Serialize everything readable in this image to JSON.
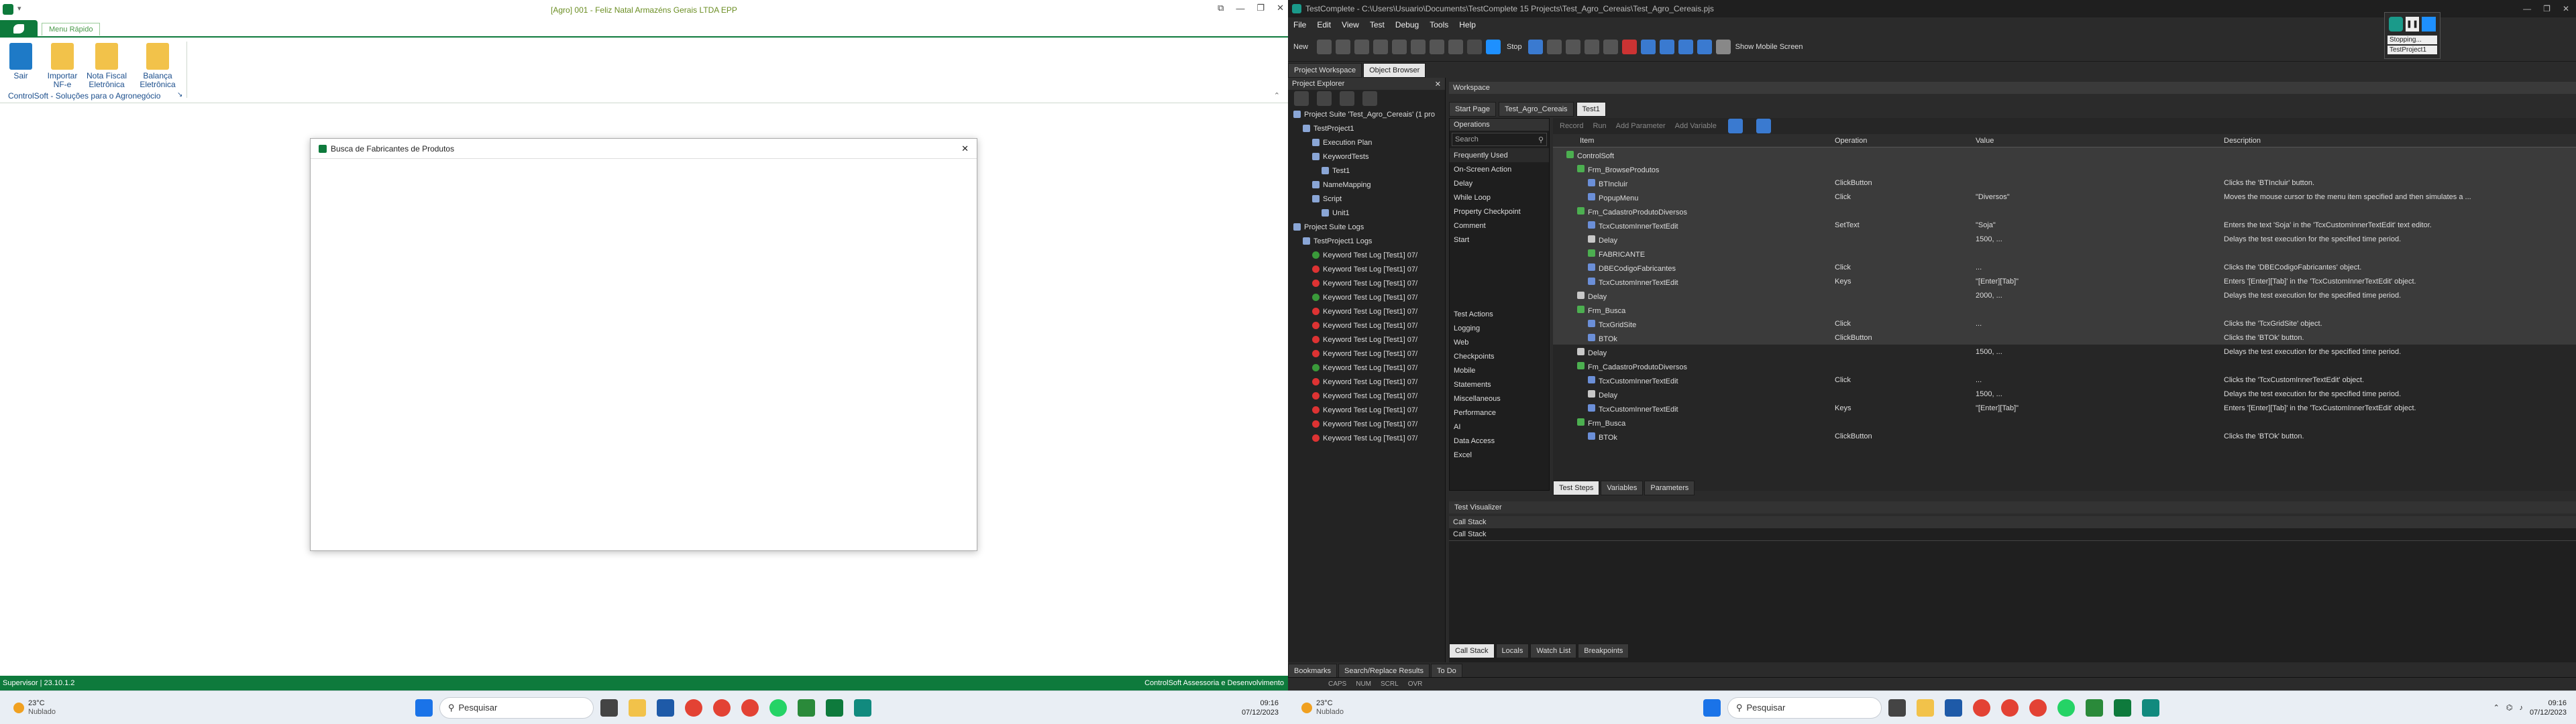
{
  "left": {
    "title": "[Agro] 001 - Feliz Natal Armazéns Gerais LTDA EPP",
    "tab": "Menu Rápido",
    "ribbon": [
      {
        "label1": "Sair",
        "label2": ""
      },
      {
        "label1": "Importar",
        "label2": "NF-e"
      },
      {
        "label1": "Nota Fiscal",
        "label2": "Eletrônica"
      },
      {
        "label1": "Balança",
        "label2": "Eletrônica"
      }
    ],
    "ribbon_group": "ControlSoft - Soluções para o Agronegócio",
    "dialog_title": "Busca de Fabricantes de Produtos",
    "status_left": "Supervisor | 23.10.1.2",
    "status_right": "ControlSoft Assessoria e Desenvolvimento",
    "weather_temp": "23°C",
    "weather_desc": "Nublado",
    "search": "Pesquisar",
    "time": "09:16",
    "date": "07/12/2023"
  },
  "right": {
    "title": "TestComplete - C:\\Users\\Usuario\\Documents\\TestComplete 15 Projects\\Test_Agro_Cereais\\Test_Agro_Cereais.pjs",
    "menu": [
      "File",
      "Edit",
      "View",
      "Test",
      "Debug",
      "Tools",
      "Help"
    ],
    "toolbar": {
      "new": "New",
      "stop": "Stop",
      "show_mobile": "Show Mobile Screen"
    },
    "notif": {
      "line1": "Stopping...",
      "line2": "TestProject1"
    },
    "tabs_left": [
      "Project Workspace",
      "Object Browser"
    ],
    "panel_title": "Project Explorer",
    "workspace_title": "Workspace",
    "doc_tabs": [
      "Start Page",
      "Test_Agro_Cereais",
      "Test1"
    ],
    "tree": [
      {
        "t": "Project Suite 'Test_Agro_Cereais' (1 pro",
        "d": 0
      },
      {
        "t": "TestProject1",
        "d": 1
      },
      {
        "t": "Execution Plan",
        "d": 2
      },
      {
        "t": "KeywordTests",
        "d": 2
      },
      {
        "t": "Test1",
        "d": 3
      },
      {
        "t": "NameMapping",
        "d": 2
      },
      {
        "t": "Script",
        "d": 2
      },
      {
        "t": "Unit1",
        "d": 3
      },
      {
        "t": "Project Suite Logs",
        "d": 0
      },
      {
        "t": "TestProject1 Logs",
        "d": 1
      },
      {
        "t": "Keyword Test Log [Test1] 07/",
        "d": 2
      },
      {
        "t": "Keyword Test Log [Test1] 07/",
        "d": 2
      },
      {
        "t": "Keyword Test Log [Test1] 07/",
        "d": 2
      },
      {
        "t": "Keyword Test Log [Test1] 07/",
        "d": 2
      },
      {
        "t": "Keyword Test Log [Test1] 07/",
        "d": 2
      },
      {
        "t": "Keyword Test Log [Test1] 07/",
        "d": 2
      },
      {
        "t": "Keyword Test Log [Test1] 07/",
        "d": 2
      },
      {
        "t": "Keyword Test Log [Test1] 07/",
        "d": 2
      },
      {
        "t": "Keyword Test Log [Test1] 07/",
        "d": 2
      },
      {
        "t": "Keyword Test Log [Test1] 07/",
        "d": 2
      },
      {
        "t": "Keyword Test Log [Test1] 07/",
        "d": 2
      },
      {
        "t": "Keyword Test Log [Test1] 07/",
        "d": 2
      },
      {
        "t": "Keyword Test Log [Test1] 07/",
        "d": 2
      },
      {
        "t": "Keyword Test Log [Test1] 07/",
        "d": 2
      }
    ],
    "log_colors": [
      "#3a9a3a",
      "#d33",
      "#d33",
      "#3a9a3a",
      "#d33",
      "#d33",
      "#d33",
      "#d33",
      "#3a9a3a",
      "#d33",
      "#d33",
      "#d33",
      "#d33",
      "#d33"
    ],
    "kw_toolbar": [
      "Record",
      "Run",
      "Add Parameter",
      "Add Variable"
    ],
    "ops_title": "Operations",
    "ops_search": "Search",
    "ops_frequent": [
      "Frequently Used",
      "On-Screen Action",
      "Delay",
      "While Loop",
      "Property Checkpoint",
      "Comment",
      "Start"
    ],
    "ops_cats": [
      "Test Actions",
      "Logging",
      "Web",
      "Checkpoints",
      "Mobile",
      "Statements",
      "Miscellaneous",
      "Performance",
      "AI",
      "Data Access",
      "Excel"
    ],
    "grid_headers": [
      "Item",
      "Operation",
      "Value",
      "Description"
    ],
    "grid": [
      {
        "i": "ControlSoft",
        "d": 0,
        "o": "",
        "v": "",
        "x": ""
      },
      {
        "i": "Frm_BrowseProdutos",
        "d": 1,
        "o": "",
        "v": "",
        "x": ""
      },
      {
        "i": "BTIncluir",
        "d": 2,
        "o": "ClickButton",
        "v": "",
        "x": "Clicks the 'BTIncluir' button."
      },
      {
        "i": "PopupMenu",
        "d": 2,
        "o": "Click",
        "v": "\"Diversos\"",
        "x": "Moves the mouse cursor to the menu item specified and then simulates a ..."
      },
      {
        "i": "Fm_CadastroProdutoDiversos",
        "d": 1,
        "o": "",
        "v": "",
        "x": ""
      },
      {
        "i": "TcxCustomInnerTextEdit",
        "d": 2,
        "o": "SetText",
        "v": "\"Soja\"",
        "x": "Enters the text 'Soja' in the 'TcxCustomInnerTextEdit' text editor."
      },
      {
        "i": "Delay",
        "d": 2,
        "o": "",
        "v": "1500, ...",
        "x": "Delays the test execution for the specified time period."
      },
      {
        "i": "FABRICANTE",
        "d": 2,
        "o": "",
        "v": "",
        "x": ""
      },
      {
        "i": "DBECodigoFabricantes",
        "d": 2,
        "o": "Click",
        "v": "...",
        "x": "Clicks the 'DBECodigoFabricantes' object."
      },
      {
        "i": "TcxCustomInnerTextEdit",
        "d": 2,
        "o": "Keys",
        "v": "\"[Enter][Tab]\"",
        "x": "Enters '[Enter][Tab]' in the 'TcxCustomInnerTextEdit' object."
      },
      {
        "i": "Delay",
        "d": 1,
        "o": "",
        "v": "2000, ...",
        "x": "Delays the test execution for the specified time period."
      },
      {
        "i": "Frm_Busca",
        "d": 1,
        "o": "",
        "v": "",
        "x": ""
      },
      {
        "i": "TcxGridSite",
        "d": 2,
        "o": "Click",
        "v": "...",
        "x": "Clicks the 'TcxGridSite' object."
      },
      {
        "i": "BTOk",
        "d": 2,
        "o": "ClickButton",
        "v": "",
        "x": "Clicks the 'BTOk' button."
      },
      {
        "i": "Delay",
        "d": 1,
        "o": "",
        "v": "1500, ...",
        "x": "Delays the test execution for the specified time period."
      },
      {
        "i": "Fm_CadastroProdutoDiversos",
        "d": 1,
        "o": "",
        "v": "",
        "x": ""
      },
      {
        "i": "TcxCustomInnerTextEdit",
        "d": 2,
        "o": "Click",
        "v": "...",
        "x": "Clicks the 'TcxCustomInnerTextEdit' object."
      },
      {
        "i": "Delay",
        "d": 2,
        "o": "",
        "v": "1500, ...",
        "x": "Delays the test execution for the specified time period."
      },
      {
        "i": "TcxCustomInnerTextEdit",
        "d": 2,
        "o": "Keys",
        "v": "\"[Enter][Tab]\"",
        "x": "Enters '[Enter][Tab]' in the 'TcxCustomInnerTextEdit' object."
      },
      {
        "i": "Frm_Busca",
        "d": 1,
        "o": "",
        "v": "",
        "x": ""
      },
      {
        "i": "BTOk",
        "d": 2,
        "o": "ClickButton",
        "v": "",
        "x": "Clicks the 'BTOk' button."
      }
    ],
    "grid_tabs": [
      "Test Steps",
      "Variables",
      "Parameters"
    ],
    "visualizer": "Test Visualizer",
    "callstack_title": "Call Stack",
    "callstack_col": "Call Stack",
    "bottom_tabs": [
      "Call Stack",
      "Locals",
      "Watch List",
      "Breakpoints"
    ],
    "left_bottom_tabs": [
      "Bookmarks",
      "Search/Replace Results",
      "To Do"
    ],
    "status": [
      "CAPS",
      "NUM",
      "SCRL",
      "OVR"
    ],
    "weather_temp": "23°C",
    "weather_desc": "Nublado",
    "search": "Pesquisar",
    "time": "09:16",
    "date": "07/12/2023"
  }
}
